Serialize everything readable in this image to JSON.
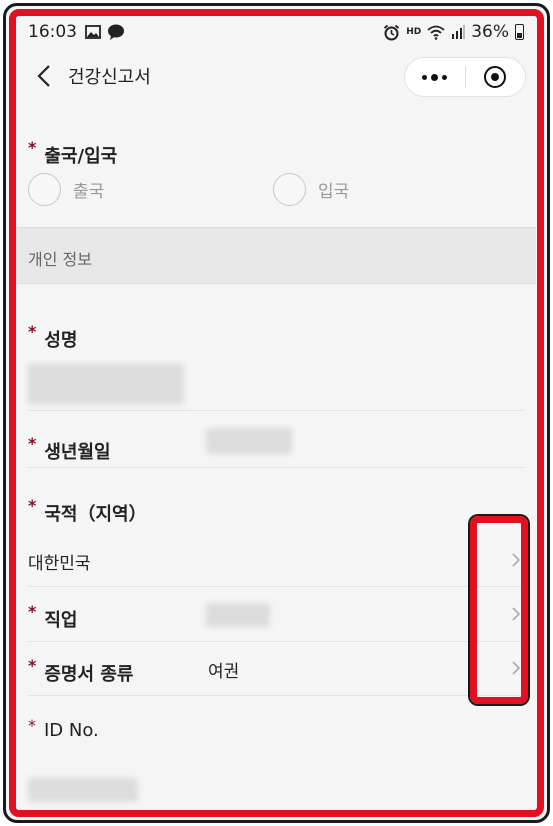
{
  "status_bar": {
    "time": "16:03",
    "battery_percent": "36%",
    "network": "HD"
  },
  "header": {
    "title": "건강신고서"
  },
  "travel_direction": {
    "label": "출국/입국",
    "required_mark": "*",
    "options": [
      "출국",
      "입국"
    ]
  },
  "personal_info": {
    "section_title": "개인 정보",
    "name_label": "성명",
    "birth_label": "생년월일",
    "nationality_label": "국적（지역）",
    "nationality_value": "대한민국",
    "occupation_label": "직업",
    "certificate_label": "증명서 종류",
    "certificate_value": "여권",
    "id_label": "ID No.",
    "required_mark": "*"
  },
  "colors": {
    "highlight": "#e3101f",
    "required_star": "#7a1020"
  }
}
